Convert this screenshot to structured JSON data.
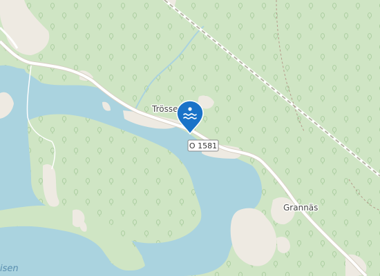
{
  "map": {
    "place_labels": {
      "trossed": "Trössed",
      "grannas": "Grannäs"
    },
    "water_label": "isen",
    "road_shield": "O 1581",
    "poi_marker": {
      "icon": "swimming-icon",
      "color": "#1a73c8"
    },
    "colors": {
      "forest": "#cfe5c4",
      "water": "#aad3df",
      "open_land": "#eeeae2",
      "road": "#ffffff",
      "railway": "#b9b9a8",
      "tree_symbol": "#a8cc9d"
    }
  }
}
